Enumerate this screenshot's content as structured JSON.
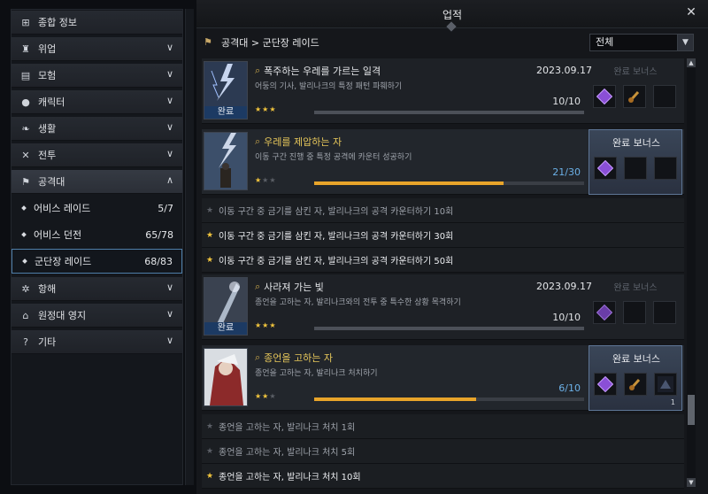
{
  "sidebar": {
    "items": [
      {
        "label": "종합 정보",
        "icon": "grid-icon"
      },
      {
        "label": "위업",
        "icon": "trophy-icon"
      },
      {
        "label": "모험",
        "icon": "book-icon"
      },
      {
        "label": "캐릭터",
        "icon": "person-icon"
      },
      {
        "label": "생활",
        "icon": "leaf-icon"
      },
      {
        "label": "전투",
        "icon": "crossed-swords-icon"
      },
      {
        "label": "공격대",
        "icon": "raid-icon"
      },
      {
        "label": "항해",
        "icon": "ship-wheel-icon"
      },
      {
        "label": "원정대 영지",
        "icon": "estate-icon"
      },
      {
        "label": "기타",
        "icon": "question-icon"
      }
    ],
    "subitems": [
      {
        "label": "어비스 레이드",
        "count": "5/7"
      },
      {
        "label": "어비스 던전",
        "count": "65/78"
      },
      {
        "label": "군단장 레이드",
        "count": "68/83"
      }
    ]
  },
  "header": {
    "title": "업적",
    "close": "✕"
  },
  "breadcrumb": "공격대 > 군단장 레이드",
  "filter": {
    "value": "전체"
  },
  "bonus_label": "완료 보너스",
  "done_label": "완료",
  "achievements": [
    {
      "name": "폭주하는 우레를 가르는 일격",
      "desc": "어둥의 기사, 발리나크의 특정 패턴 파훼하기",
      "date": "2023.09.17",
      "progress_text": "10/10",
      "progress": 1.0,
      "stars": 3,
      "completed": true
    },
    {
      "name": "우레를 제압하는 자",
      "desc": "이동 구간 진행 중 특정 공격에 카운터 성공하기",
      "date": "",
      "progress_text": "21/30",
      "progress": 0.7,
      "stars": 1,
      "completed": false
    },
    {
      "name": "사라져 가는 빛",
      "desc": "종언을 고하는 자, 발리나크와의 전투 중 특수한 상황 목격하기",
      "date": "2023.09.17",
      "progress_text": "10/10",
      "progress": 1.0,
      "stars": 3,
      "completed": true
    },
    {
      "name": "종언을 고하는 자",
      "desc": "종언을 고하는 자, 발리나크 처치하기",
      "date": "",
      "progress_text": "6/10",
      "progress": 0.6,
      "stars": 2,
      "completed": false
    }
  ],
  "subrows_a": [
    {
      "text": "이동 구간 중 금기를 삼킨 자, 발리나크의 공격 카운터하기 10회",
      "done": false
    },
    {
      "text": "이동 구간 중 금기를 삼킨 자, 발리나크의 공격 카운터하기 30회",
      "done": true
    },
    {
      "text": "이동 구간 중 금기를 삼킨 자, 발리나크의 공격 카운터하기 50회",
      "done": true
    }
  ],
  "subrows_b": [
    {
      "text": "종언을 고하는 자, 발리나크 처치 1회",
      "done": false
    },
    {
      "text": "종언을 고하는 자, 발리나크 처치 5회",
      "done": false
    },
    {
      "text": "종언을 고하는 자, 발리나크 처치 10회",
      "done": true
    }
  ],
  "reward_qty": "1",
  "colors": {
    "accent_gold": "#e6c65a",
    "progress_orange": "#e8a42a",
    "progress_blue": "#6cb1e8",
    "active_border": "#4e7ea8"
  }
}
